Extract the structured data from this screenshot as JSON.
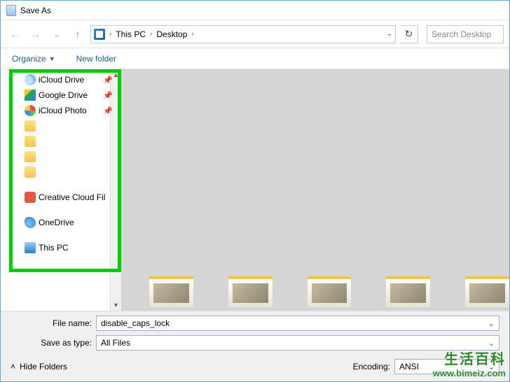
{
  "title": "Save As",
  "nav": {
    "back": "←",
    "fwd": "→",
    "up": "↑"
  },
  "breadcrumb": {
    "root": "This PC",
    "leaf": "Desktop"
  },
  "search_placeholder": "Search Desktop",
  "toolbar": {
    "organize": "Organize",
    "newfolder": "New folder"
  },
  "tree": {
    "items": [
      {
        "label": "iCloud Drive",
        "icon": "ic-cloud",
        "pinned": true
      },
      {
        "label": "Google Drive",
        "icon": "ic-gdrive",
        "pinned": true
      },
      {
        "label": "iCloud Photo",
        "icon": "ic-photos",
        "pinned": true
      },
      {
        "label": "",
        "icon": "ic-folder",
        "pinned": false
      },
      {
        "label": "",
        "icon": "ic-folder",
        "pinned": false
      },
      {
        "label": "",
        "icon": "ic-folder",
        "pinned": false
      },
      {
        "label": "",
        "icon": "ic-folder",
        "pinned": false
      },
      {
        "label": "Creative Cloud Fil",
        "icon": "ic-cc",
        "pinned": false,
        "gap": true
      },
      {
        "label": "OneDrive",
        "icon": "ic-onedrive",
        "pinned": false,
        "gap": true
      },
      {
        "label": "This PC",
        "icon": "ic-pc",
        "pinned": false,
        "gap": true,
        "trunc": true
      }
    ]
  },
  "fields": {
    "filename_label": "File name:",
    "filename_value": "disable_caps_lock",
    "type_label": "Save as type:",
    "type_value": "All Files",
    "encoding_label": "Encoding:",
    "encoding_value": "ANSI"
  },
  "hidefolders": "Hide Folders",
  "watermark": {
    "cn": "生活百科",
    "url": "www.bimeiz.com"
  }
}
